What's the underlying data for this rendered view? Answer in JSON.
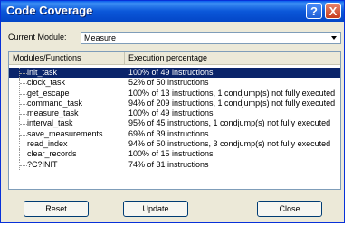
{
  "window": {
    "title": "Code Coverage",
    "help_label": "?",
    "close_label": "X"
  },
  "module": {
    "label": "Current Module:",
    "value": "Measure"
  },
  "table": {
    "headers": [
      "Modules/Functions",
      "Execution percentage"
    ],
    "rows": [
      {
        "name": "init_task",
        "exec": "100% of 49 instructions"
      },
      {
        "name": "clock_task",
        "exec": "52% of 50 instructions"
      },
      {
        "name": "get_escape",
        "exec": "100% of 13 instructions, 1 condjump(s) not fully executed"
      },
      {
        "name": "command_task",
        "exec": "94% of 209 instructions, 1 condjump(s) not fully executed"
      },
      {
        "name": "measure_task",
        "exec": "100% of 49 instructions"
      },
      {
        "name": "interval_task",
        "exec": "95% of 45 instructions, 1 condjump(s) not fully executed"
      },
      {
        "name": "save_measurements",
        "exec": "69% of 39 instructions"
      },
      {
        "name": "read_index",
        "exec": "94% of 50 instructions, 3 condjump(s) not fully executed"
      },
      {
        "name": "clear_records",
        "exec": "100% of 15 instructions"
      },
      {
        "name": "?C?INIT",
        "exec": "74% of 31 instructions"
      }
    ]
  },
  "buttons": {
    "reset": "Reset",
    "update": "Update",
    "close": "Close"
  }
}
